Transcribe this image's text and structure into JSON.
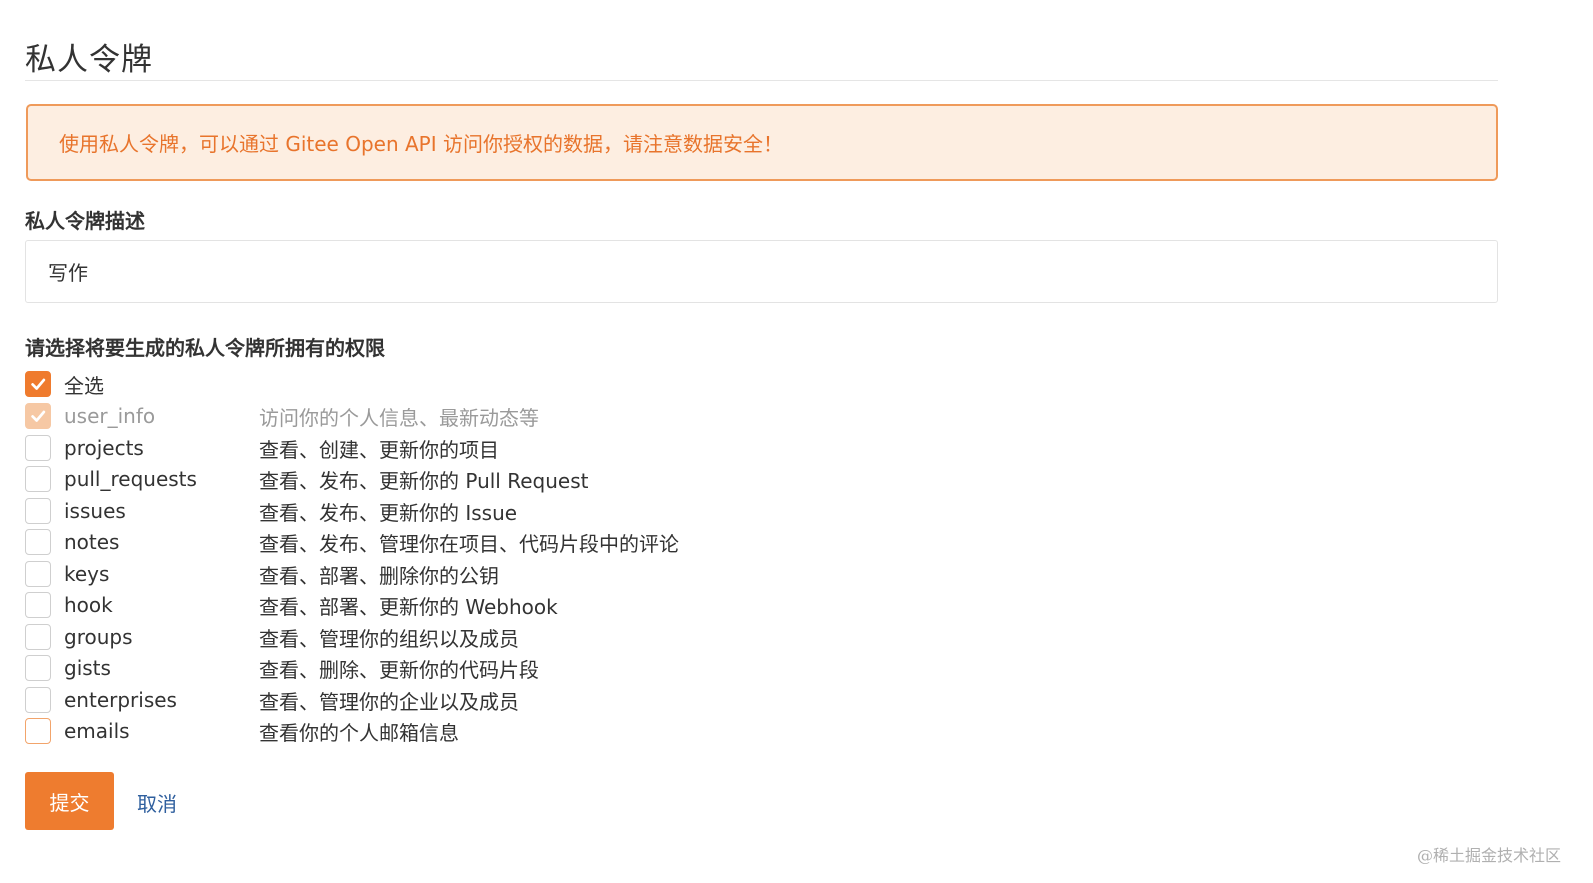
{
  "page": {
    "title": "私人令牌"
  },
  "alert": {
    "text": "使用私人令牌，可以通过 Gitee Open API 访问你授权的数据，请注意数据安全！"
  },
  "description_field": {
    "label": "私人令牌描述",
    "value": "写作"
  },
  "permissions": {
    "label": "请选择将要生成的私人令牌所拥有的权限",
    "select_all": {
      "label": "全选",
      "checked": true
    },
    "scopes": [
      {
        "name": "user_info",
        "desc": "访问你的个人信息、最新动态等",
        "checked": true,
        "disabled": true
      },
      {
        "name": "projects",
        "desc": "查看、创建、更新你的项目",
        "checked": false
      },
      {
        "name": "pull_requests",
        "desc": "查看、发布、更新你的 Pull Request",
        "checked": false
      },
      {
        "name": "issues",
        "desc": "查看、发布、更新你的 Issue",
        "checked": false
      },
      {
        "name": "notes",
        "desc": "查看、发布、管理你在项目、代码片段中的评论",
        "checked": false
      },
      {
        "name": "keys",
        "desc": "查看、部署、删除你的公钥",
        "checked": false
      },
      {
        "name": "hook",
        "desc": "查看、部署、更新你的 Webhook",
        "checked": false
      },
      {
        "name": "groups",
        "desc": "查看、管理你的组织以及成员",
        "checked": false
      },
      {
        "name": "gists",
        "desc": "查看、删除、更新你的代码片段",
        "checked": false
      },
      {
        "name": "enterprises",
        "desc": "查看、管理你的企业以及成员",
        "checked": false
      },
      {
        "name": "emails",
        "desc": "查看你的个人邮箱信息",
        "checked": false,
        "focused": true
      }
    ]
  },
  "actions": {
    "submit_label": "提交",
    "cancel_label": "取消"
  },
  "watermark": "@稀土掘金技术社区",
  "colors": {
    "accent": "#ee7c2f",
    "alert_bg": "#fdeee1",
    "alert_border": "#ef9a5a",
    "link": "#2f5f9e"
  }
}
